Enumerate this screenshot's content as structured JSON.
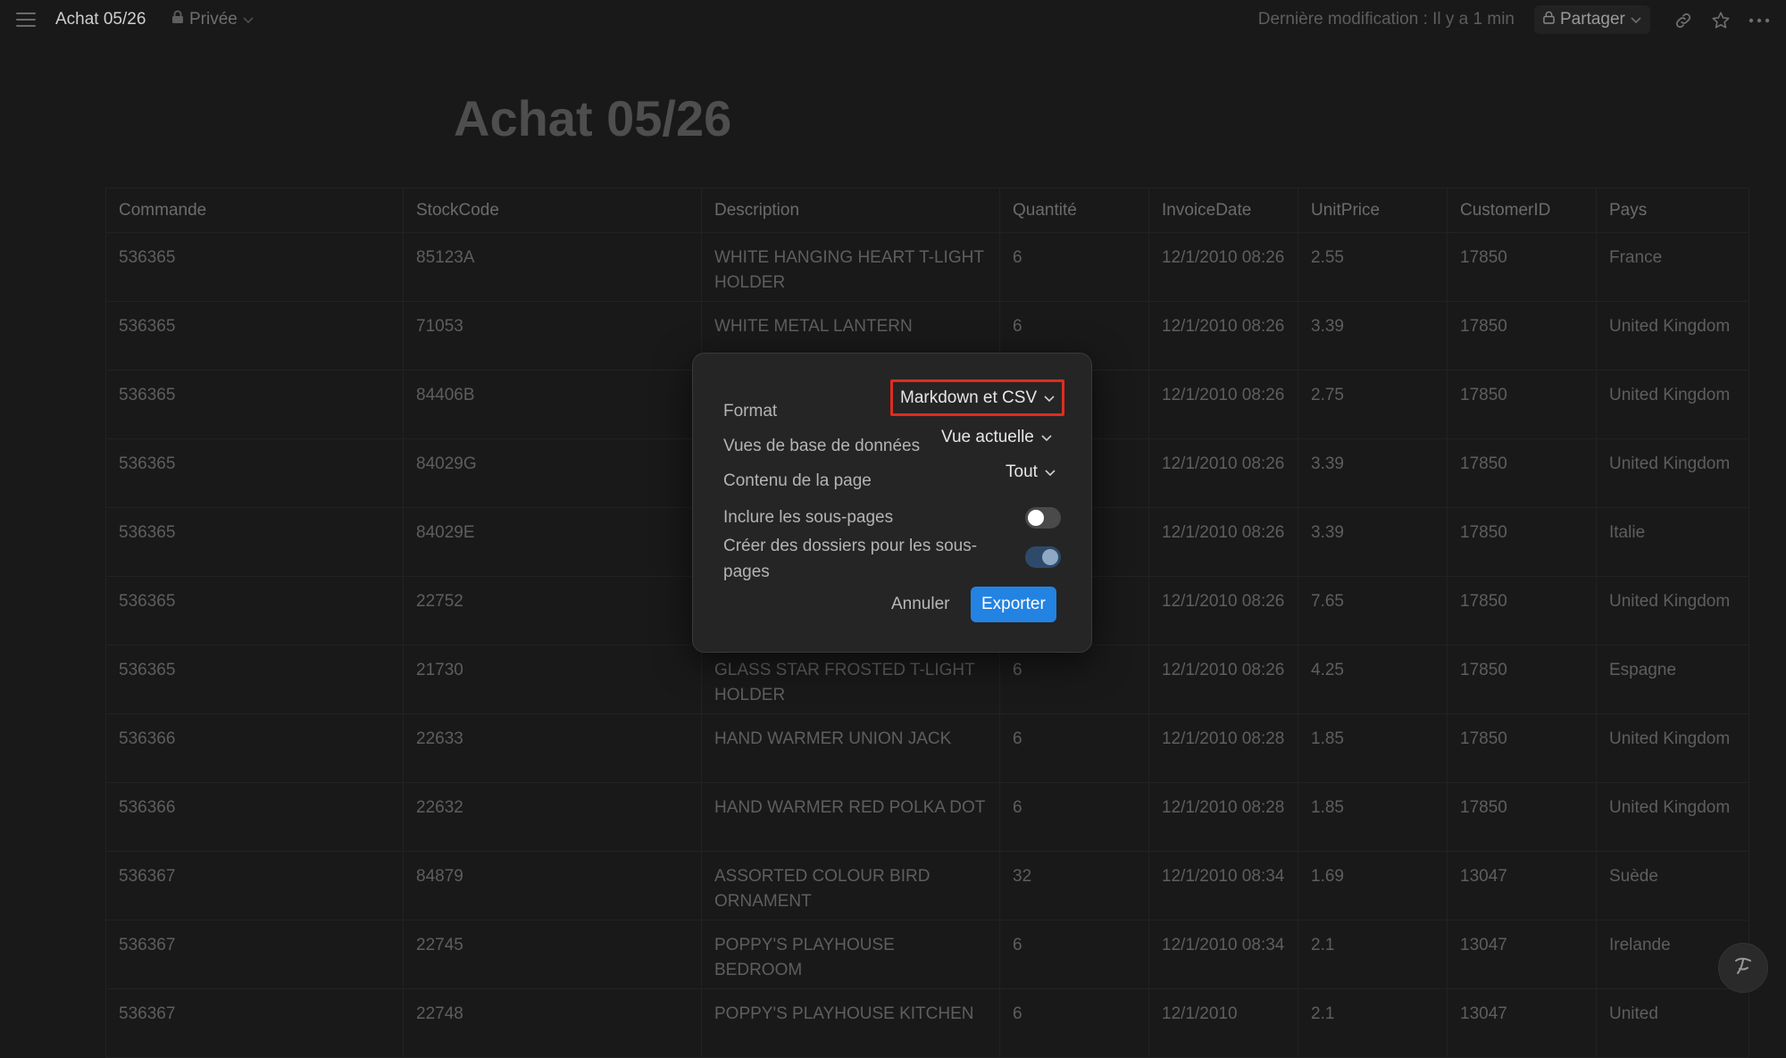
{
  "topbar": {
    "title": "Achat 05/26",
    "privacy": "Privée",
    "last_edit": "Dernière modification : Il y a 1 min",
    "share": "Partager"
  },
  "page": {
    "title": "Achat 05/26"
  },
  "table": {
    "headers": [
      "Commande",
      "StockCode",
      "Description",
      "Quantité",
      "InvoiceDate",
      "UnitPrice",
      "CustomerID",
      "Pays"
    ],
    "rows": [
      [
        "536365",
        "85123A",
        "WHITE HANGING HEART T-LIGHT HOLDER",
        "6",
        "12/1/2010 08:26",
        "2.55",
        "17850",
        "France"
      ],
      [
        "536365",
        "71053",
        "WHITE METAL LANTERN",
        "6",
        "12/1/2010 08:26",
        "3.39",
        "17850",
        "United Kingdom"
      ],
      [
        "536365",
        "84406B",
        "",
        "",
        "12/1/2010 08:26",
        "2.75",
        "17850",
        "United Kingdom"
      ],
      [
        "536365",
        "84029G",
        "",
        "",
        "12/1/2010 08:26",
        "3.39",
        "17850",
        "United Kingdom"
      ],
      [
        "536365",
        "84029E",
        "",
        "",
        "12/1/2010 08:26",
        "3.39",
        "17850",
        "Italie"
      ],
      [
        "536365",
        "22752",
        "",
        "",
        "12/1/2010 08:26",
        "7.65",
        "17850",
        "United Kingdom"
      ],
      [
        "536365",
        "21730",
        "GLASS STAR FROSTED T-LIGHT HOLDER",
        "6",
        "12/1/2010 08:26",
        "4.25",
        "17850",
        "Espagne"
      ],
      [
        "536366",
        "22633",
        "HAND WARMER UNION JACK",
        "6",
        "12/1/2010 08:28",
        "1.85",
        "17850",
        "United Kingdom"
      ],
      [
        "536366",
        "22632",
        "HAND WARMER RED POLKA DOT",
        "6",
        "12/1/2010 08:28",
        "1.85",
        "17850",
        "United Kingdom"
      ],
      [
        "536367",
        "84879",
        "ASSORTED COLOUR BIRD ORNAMENT",
        "32",
        "12/1/2010 08:34",
        "1.69",
        "13047",
        "Suède"
      ],
      [
        "536367",
        "22745",
        "POPPY'S PLAYHOUSE BEDROOM",
        "6",
        "12/1/2010 08:34",
        "2.1",
        "13047",
        "Irelande"
      ],
      [
        "536367",
        "22748",
        "POPPY'S PLAYHOUSE KITCHEN",
        "6",
        "12/1/2010",
        "2.1",
        "13047",
        "United"
      ]
    ]
  },
  "export_dialog": {
    "format_label": "Format",
    "format_value": "Markdown et CSV",
    "db_views_label": "Vues de base de données",
    "db_views_value": "Vue actuelle",
    "page_content_label": "Contenu de la page",
    "page_content_value": "Tout",
    "include_subpages_label": "Inclure les sous-pages",
    "include_subpages_on": false,
    "create_folders_label": "Créer des dossiers pour les sous-pages",
    "create_folders_on": true,
    "cancel_label": "Annuler",
    "export_label": "Exporter"
  },
  "colors": {
    "accent": "#2383e2",
    "highlight": "#e02c1f",
    "background": "#191919"
  }
}
